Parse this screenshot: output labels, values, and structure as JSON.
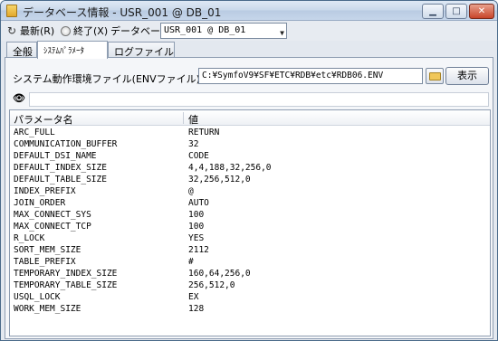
{
  "window": {
    "title": "データベース情報 - USR_001 @ DB_01"
  },
  "toolbar": {
    "refresh_label": "最新(R)",
    "exit_label": "終了(X)",
    "database_label": "データベース",
    "database_value": "USR_001 @ DB_01"
  },
  "tabs": [
    {
      "label": "全般"
    },
    {
      "label": "ｼｽﾃﾑﾊﾟﾗﾒｰﾀ"
    },
    {
      "label": "ログファイル"
    }
  ],
  "env": {
    "label": "システム動作環境ファイル(ENVファイル)",
    "path": "C:¥SymfoV9¥SF¥ETC¥RDB¥etc¥RDB06.ENV",
    "show_label": "表示"
  },
  "list": {
    "columns": [
      "パラメータ名",
      "値"
    ],
    "rows": [
      {
        "name": "ARC_FULL",
        "value": "RETURN"
      },
      {
        "name": "COMMUNICATION_BUFFER",
        "value": "32"
      },
      {
        "name": "DEFAULT_DSI_NAME",
        "value": "CODE"
      },
      {
        "name": "DEFAULT_INDEX_SIZE",
        "value": "4,4,188,32,256,0"
      },
      {
        "name": "DEFAULT_TABLE_SIZE",
        "value": "32,256,512,0"
      },
      {
        "name": "INDEX_PREFIX",
        "value": "@"
      },
      {
        "name": "JOIN_ORDER",
        "value": "AUTO"
      },
      {
        "name": "MAX_CONNECT_SYS",
        "value": "100"
      },
      {
        "name": "MAX_CONNECT_TCP",
        "value": "100"
      },
      {
        "name": "R_LOCK",
        "value": "YES"
      },
      {
        "name": "SORT_MEM_SIZE",
        "value": "2112"
      },
      {
        "name": "TABLE_PREFIX",
        "value": "#"
      },
      {
        "name": "TEMPORARY_INDEX_SIZE",
        "value": "160,64,256,0"
      },
      {
        "name": "TEMPORARY_TABLE_SIZE",
        "value": "256,512,0"
      },
      {
        "name": "USQL_LOCK",
        "value": "EX"
      },
      {
        "name": "WORK_MEM_SIZE",
        "value": "128"
      }
    ]
  }
}
